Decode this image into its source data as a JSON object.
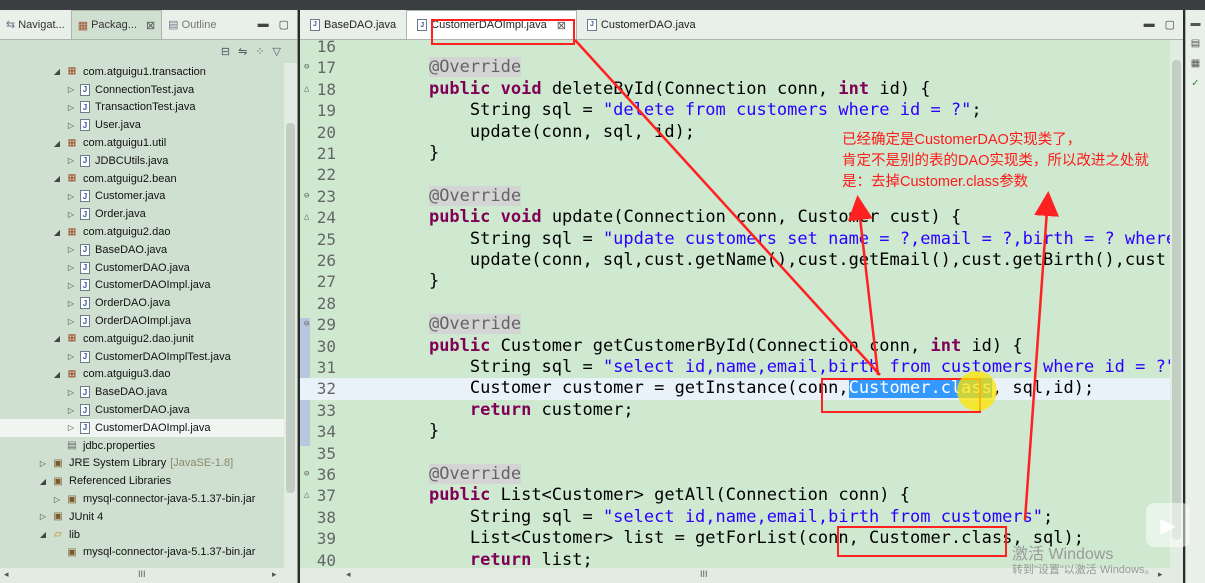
{
  "left_pane": {
    "tabs": [
      {
        "label": "Navigat...",
        "icon": "navigator-icon"
      },
      {
        "label": "Packag...",
        "icon": "package-explorer-icon",
        "close": "⊠"
      },
      {
        "label": "Outline",
        "icon": "outline-icon"
      }
    ],
    "tree": [
      {
        "indent": 3,
        "twisty": "◢",
        "icon": "pkg",
        "label": "com.atguigu1.transaction"
      },
      {
        "indent": 4,
        "twisty": "▷",
        "icon": "java",
        "label": "ConnectionTest.java"
      },
      {
        "indent": 4,
        "twisty": "▷",
        "icon": "java",
        "label": "TransactionTest.java"
      },
      {
        "indent": 4,
        "twisty": "▷",
        "icon": "java",
        "label": "User.java"
      },
      {
        "indent": 3,
        "twisty": "◢",
        "icon": "pkg",
        "label": "com.atguigu1.util"
      },
      {
        "indent": 4,
        "twisty": "▷",
        "icon": "java",
        "label": "JDBCUtils.java"
      },
      {
        "indent": 3,
        "twisty": "◢",
        "icon": "pkg",
        "label": "com.atguigu2.bean"
      },
      {
        "indent": 4,
        "twisty": "▷",
        "icon": "java",
        "label": "Customer.java"
      },
      {
        "indent": 4,
        "twisty": "▷",
        "icon": "java",
        "label": "Order.java"
      },
      {
        "indent": 3,
        "twisty": "◢",
        "icon": "pkg",
        "label": "com.atguigu2.dao"
      },
      {
        "indent": 4,
        "twisty": "▷",
        "icon": "java",
        "label": "BaseDAO.java"
      },
      {
        "indent": 4,
        "twisty": "▷",
        "icon": "java",
        "label": "CustomerDAO.java"
      },
      {
        "indent": 4,
        "twisty": "▷",
        "icon": "java",
        "label": "CustomerDAOImpl.java"
      },
      {
        "indent": 4,
        "twisty": "▷",
        "icon": "java",
        "label": "OrderDAO.java"
      },
      {
        "indent": 4,
        "twisty": "▷",
        "icon": "java",
        "label": "OrderDAOImpl.java"
      },
      {
        "indent": 3,
        "twisty": "◢",
        "icon": "pkg",
        "label": "com.atguigu2.dao.junit"
      },
      {
        "indent": 4,
        "twisty": "▷",
        "icon": "java",
        "label": "CustomerDAOImplTest.java"
      },
      {
        "indent": 3,
        "twisty": "◢",
        "icon": "pkg",
        "label": "com.atguigu3.dao"
      },
      {
        "indent": 4,
        "twisty": "▷",
        "icon": "java",
        "label": "BaseDAO.java"
      },
      {
        "indent": 4,
        "twisty": "▷",
        "icon": "java",
        "label": "CustomerDAO.java"
      },
      {
        "indent": 4,
        "twisty": "▷",
        "icon": "java",
        "label": "CustomerDAOImpl.java",
        "selected": true
      },
      {
        "indent": 3,
        "twisty": "",
        "icon": "props",
        "label": "jdbc.properties"
      },
      {
        "indent": 2,
        "twisty": "▷",
        "icon": "jar",
        "label": "JRE System Library",
        "extra": "[JavaSE-1.8]"
      },
      {
        "indent": 2,
        "twisty": "◢",
        "icon": "jar",
        "label": "Referenced Libraries"
      },
      {
        "indent": 3,
        "twisty": "▷",
        "icon": "jar",
        "label": "mysql-connector-java-5.1.37-bin.jar"
      },
      {
        "indent": 2,
        "twisty": "▷",
        "icon": "jar",
        "label": "JUnit 4"
      },
      {
        "indent": 2,
        "twisty": "◢",
        "icon": "folder",
        "label": "lib"
      },
      {
        "indent": 3,
        "twisty": "",
        "icon": "jar",
        "label": "mysql-connector-java-5.1.37-bin.jar"
      }
    ],
    "hscroll_mark": "III"
  },
  "editor": {
    "tabs": [
      {
        "label": "BaseDAO.java",
        "active": false
      },
      {
        "label": "CustomerDAOImpl.java",
        "active": true,
        "close": "⊠"
      },
      {
        "label": "CustomerDAO.java",
        "active": false
      }
    ],
    "lines": [
      {
        "n": "16",
        "fold": "",
        "code": [
          {
            "t": ""
          }
        ]
      },
      {
        "n": "17",
        "fold": "⊖",
        "code": [
          {
            "t": "    "
          },
          {
            "t": "@Override",
            "c": "anno-hl"
          }
        ]
      },
      {
        "n": "18",
        "fold": "△",
        "code": [
          {
            "t": "    "
          },
          {
            "t": "public",
            "c": "kw"
          },
          {
            "t": " "
          },
          {
            "t": "void",
            "c": "kw"
          },
          {
            "t": " deleteById(Connection conn, "
          },
          {
            "t": "int",
            "c": "kw"
          },
          {
            "t": " id) {"
          }
        ]
      },
      {
        "n": "19",
        "fold": "",
        "code": [
          {
            "t": "        String sql = "
          },
          {
            "t": "\"delete from customers where id = ?\"",
            "c": "str"
          },
          {
            "t": ";"
          }
        ]
      },
      {
        "n": "20",
        "fold": "",
        "code": [
          {
            "t": "        update(conn, sql, id);"
          }
        ]
      },
      {
        "n": "21",
        "fold": "",
        "code": [
          {
            "t": "    }"
          }
        ]
      },
      {
        "n": "22",
        "fold": "",
        "code": [
          {
            "t": ""
          }
        ]
      },
      {
        "n": "23",
        "fold": "⊖",
        "code": [
          {
            "t": "    "
          },
          {
            "t": "@Override",
            "c": "anno-hl"
          }
        ]
      },
      {
        "n": "24",
        "fold": "△",
        "code": [
          {
            "t": "    "
          },
          {
            "t": "public",
            "c": "kw"
          },
          {
            "t": " "
          },
          {
            "t": "void",
            "c": "kw"
          },
          {
            "t": " update(Connection conn, Customer cust) {"
          }
        ]
      },
      {
        "n": "25",
        "fold": "",
        "code": [
          {
            "t": "        String sql = "
          },
          {
            "t": "\"update customers set name = ?,email = ?,birth = ? where",
            "c": "str"
          }
        ]
      },
      {
        "n": "26",
        "fold": "",
        "code": [
          {
            "t": "        update(conn, sql,cust.getName(),cust.getEmail(),cust.getBirth(),cust"
          }
        ]
      },
      {
        "n": "27",
        "fold": "",
        "code": [
          {
            "t": "    }"
          }
        ]
      },
      {
        "n": "28",
        "fold": "",
        "code": [
          {
            "t": ""
          }
        ]
      },
      {
        "n": "29",
        "fold": "⊖",
        "code": [
          {
            "t": "    "
          },
          {
            "t": "@Override",
            "c": "anno-hl"
          }
        ]
      },
      {
        "n": "30",
        "fold": "",
        "code": [
          {
            "t": "    "
          },
          {
            "t": "public",
            "c": "kw"
          },
          {
            "t": " Customer getCustomerById(Connection conn, "
          },
          {
            "t": "int",
            "c": "kw"
          },
          {
            "t": " id) {"
          }
        ]
      },
      {
        "n": "31",
        "fold": "",
        "code": [
          {
            "t": "        String sql = "
          },
          {
            "t": "\"select id,name,email,birth from customers where id = ?\"",
            "c": "str"
          }
        ]
      },
      {
        "n": "32",
        "fold": "",
        "current": true,
        "code": [
          {
            "t": "        Customer customer = getInstance(conn,"
          },
          {
            "t": "Customer.class",
            "c": "sel"
          },
          {
            "t": ", sql,id);"
          }
        ]
      },
      {
        "n": "33",
        "fold": "",
        "code": [
          {
            "t": "        "
          },
          {
            "t": "return",
            "c": "kw"
          },
          {
            "t": " customer;"
          }
        ]
      },
      {
        "n": "34",
        "fold": "",
        "code": [
          {
            "t": "    }"
          }
        ]
      },
      {
        "n": "35",
        "fold": "",
        "code": [
          {
            "t": ""
          }
        ]
      },
      {
        "n": "36",
        "fold": "⊖",
        "code": [
          {
            "t": "    "
          },
          {
            "t": "@Override",
            "c": "anno-hl"
          }
        ]
      },
      {
        "n": "37",
        "fold": "△",
        "code": [
          {
            "t": "    "
          },
          {
            "t": "public",
            "c": "kw"
          },
          {
            "t": " List<Customer> getAll(Connection conn) {"
          }
        ]
      },
      {
        "n": "38",
        "fold": "",
        "code": [
          {
            "t": "        String sql = "
          },
          {
            "t": "\"select id,name,email,birth from customers\"",
            "c": "str"
          },
          {
            "t": ";"
          }
        ]
      },
      {
        "n": "39",
        "fold": "",
        "code": [
          {
            "t": "        List<Customer> list = getForList(conn, Customer.class, sql);"
          }
        ]
      },
      {
        "n": "40",
        "fold": "",
        "code": [
          {
            "t": "        "
          },
          {
            "t": "return",
            "c": "kw"
          },
          {
            "t": " list;"
          }
        ]
      }
    ],
    "hscroll_mark": "III"
  },
  "annotation": {
    "note_lines": [
      "已经确定是CustomerDAO实现类了，",
      "肯定不是别的表的DAO实现类，所以改进之处就",
      "是：去掉Customer.class参数"
    ],
    "color": "#ff1a1a"
  },
  "watermark": {
    "line1": "激活 Windows",
    "line2": "转到\"设置\"以激活 Windows。"
  },
  "colors": {
    "editor_bg": "#cfe8d0",
    "keyword": "#7f0055",
    "string": "#2a00ff",
    "selection": "#3399ff",
    "annotation_red": "#ff1a1a"
  }
}
